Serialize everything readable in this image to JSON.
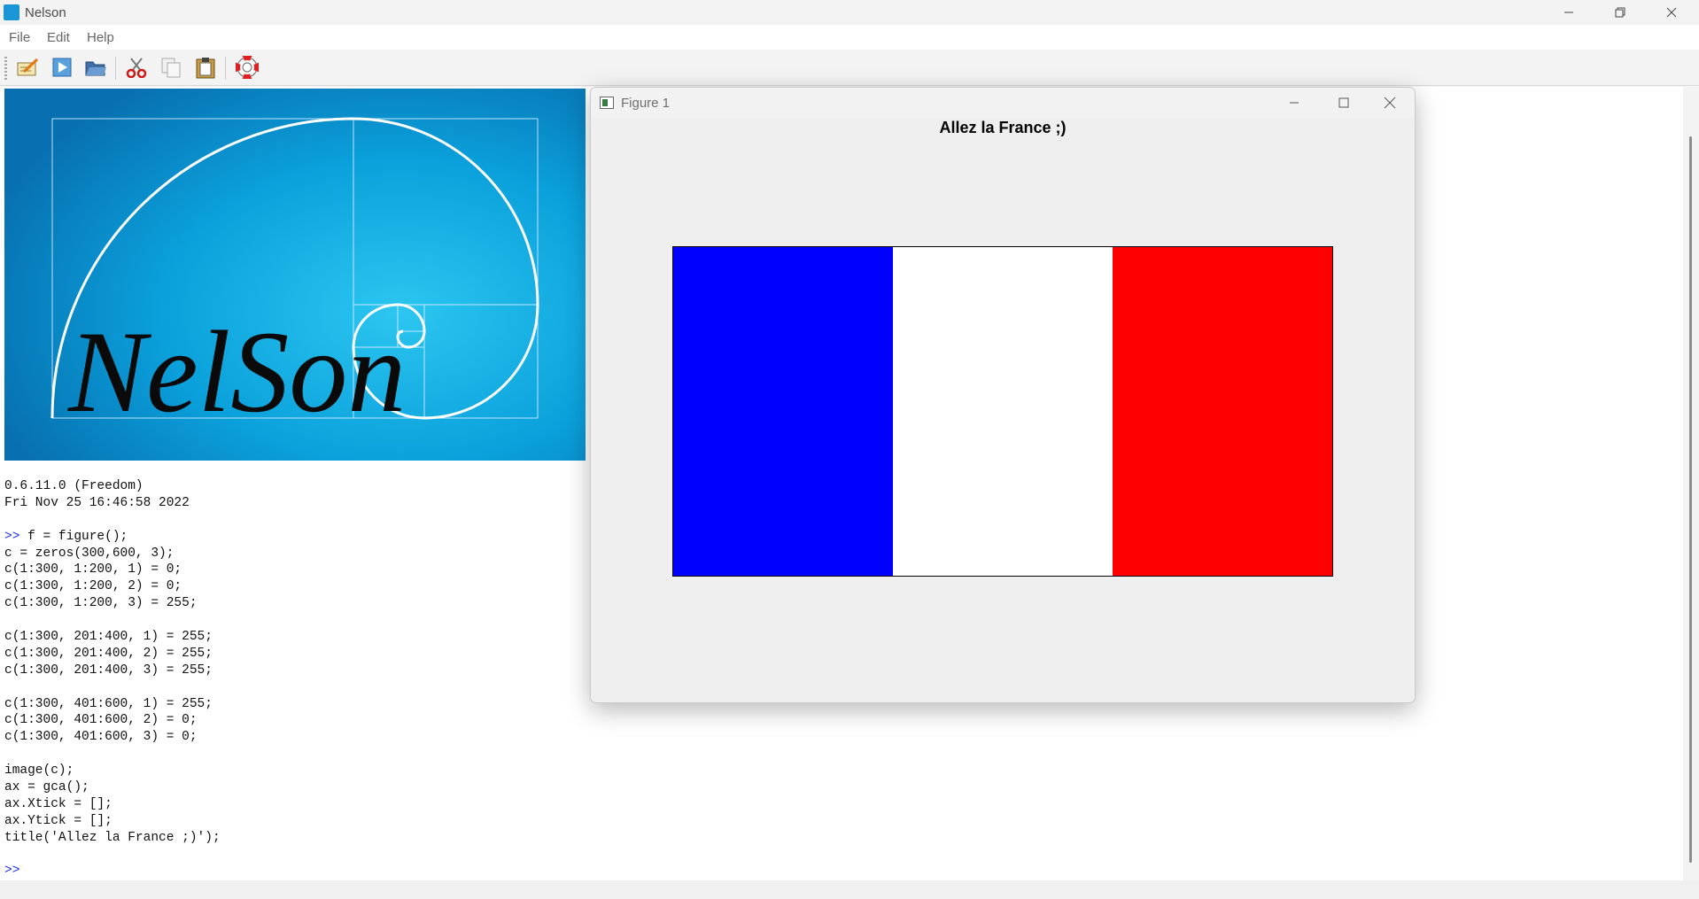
{
  "app": {
    "title": "Nelson",
    "window_controls": [
      "minimize-icon",
      "restore-icon",
      "close-icon"
    ]
  },
  "menu": [
    "File",
    "Edit",
    "Help"
  ],
  "toolbar": {
    "buttons": [
      "editor-icon",
      "run-icon",
      "open-folder-icon",
      "cut-icon",
      "copy-icon",
      "paste-icon",
      "help-lifebuoy-icon"
    ]
  },
  "logo": {
    "text": "NelSon",
    "colors": {
      "bg_center": "#27c0ee",
      "bg_edge": "#0a78b6",
      "lines": "#ffffff",
      "text": "#000000"
    }
  },
  "console": {
    "lines": [
      {
        "prompt": "",
        "text": "0.6.11.0 (Freedom)"
      },
      {
        "prompt": "",
        "text": "Fri Nov 25 16:46:58 2022"
      },
      {
        "prompt": "",
        "text": ""
      },
      {
        "prompt": ">> ",
        "text": "f = figure();"
      },
      {
        "prompt": "",
        "text": "c = zeros(300,600, 3);"
      },
      {
        "prompt": "",
        "text": "c(1:300, 1:200, 1) = 0;"
      },
      {
        "prompt": "",
        "text": "c(1:300, 1:200, 2) = 0;"
      },
      {
        "prompt": "",
        "text": "c(1:300, 1:200, 3) = 255;"
      },
      {
        "prompt": "",
        "text": ""
      },
      {
        "prompt": "",
        "text": "c(1:300, 201:400, 1) = 255;"
      },
      {
        "prompt": "",
        "text": "c(1:300, 201:400, 2) = 255;"
      },
      {
        "prompt": "",
        "text": "c(1:300, 201:400, 3) = 255;"
      },
      {
        "prompt": "",
        "text": ""
      },
      {
        "prompt": "",
        "text": "c(1:300, 401:600, 1) = 255;"
      },
      {
        "prompt": "",
        "text": "c(1:300, 401:600, 2) = 0;"
      },
      {
        "prompt": "",
        "text": "c(1:300, 401:600, 3) = 0;"
      },
      {
        "prompt": "",
        "text": ""
      },
      {
        "prompt": "",
        "text": "image(c);"
      },
      {
        "prompt": "",
        "text": "ax = gca();"
      },
      {
        "prompt": "",
        "text": "ax.Xtick = [];"
      },
      {
        "prompt": "",
        "text": "ax.Ytick = [];"
      },
      {
        "prompt": "",
        "text": "title('Allez la France ;)');"
      },
      {
        "prompt": "",
        "text": ""
      },
      {
        "prompt": ">>",
        "text": ""
      }
    ],
    "prompt_color": "#1c2ee6"
  },
  "figure": {
    "window_title": "Figure 1",
    "window_controls": [
      "minimize-icon",
      "maximize-icon",
      "close-icon"
    ],
    "plot_title": "Allez la France ;)",
    "image_stripes": [
      "#0000ff",
      "#ffffff",
      "#ff0000"
    ]
  }
}
